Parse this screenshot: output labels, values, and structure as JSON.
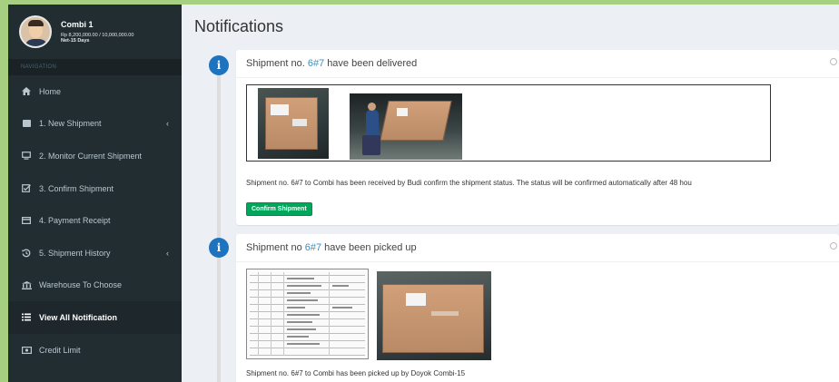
{
  "user": {
    "name": "Combi 1",
    "credit": "Rp 8,200,000.00 / 10,000,000.00",
    "terms": "Net-15 Days"
  },
  "sidebar": {
    "header": "NAVIGATION",
    "items": [
      {
        "label": "Home",
        "icon": "home-icon"
      },
      {
        "label": "1. New Shipment",
        "icon": "box-icon",
        "chevron": "‹"
      },
      {
        "label": "2. Monitor Current Shipment",
        "icon": "monitor-icon"
      },
      {
        "label": "3. Confirm Shipment",
        "icon": "check-square-icon"
      },
      {
        "label": "4. Payment Receipt",
        "icon": "credit-card-icon"
      },
      {
        "label": "5. Shipment History",
        "icon": "history-icon",
        "chevron": "‹"
      },
      {
        "label": "Warehouse To Choose",
        "icon": "bank-icon"
      },
      {
        "label": "View All Notification",
        "icon": "list-icon",
        "active": true
      },
      {
        "label": "Credit Limit",
        "icon": "money-icon"
      }
    ]
  },
  "page": {
    "title": "Notifications"
  },
  "notifications": [
    {
      "icon": "i",
      "title_prefix": "Shipment no.",
      "shipment_link": "6#7",
      "title_suffix": "have been delivered",
      "message": "Shipment no. 6#7 to Combi has been received by Budi confirm the shipment status. The status will be confirmed automatically after 48 hou",
      "button_label": "Confirm Shipment"
    },
    {
      "icon": "i",
      "title_prefix": "Shipment no",
      "shipment_link": "6#7",
      "title_suffix": "have been picked up",
      "message": "Shipment no. 6#7 to Combi has been picked up by Doyok Combi-15"
    }
  ],
  "colors": {
    "sidebar_bg": "#222d32",
    "accent": "#3c8dbc",
    "info_badge": "#1e73be",
    "success": "#00a65a",
    "outer_bg": "#a7cf82"
  }
}
